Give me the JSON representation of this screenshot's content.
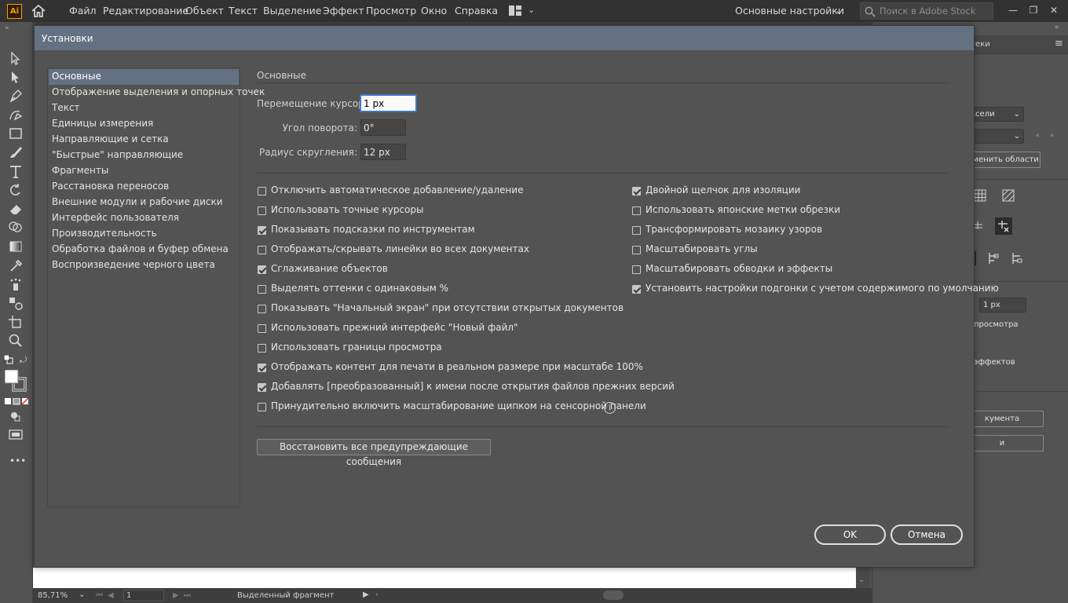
{
  "app": {
    "logo_text": "Ai",
    "menu": [
      "Файл",
      "Редактирование",
      "Объект",
      "Текст",
      "Выделение",
      "Эффект",
      "Просмотр",
      "Окно",
      "Справка"
    ],
    "workspace": "Основные настройки",
    "search_placeholder": "Поиск в Adobe Stock",
    "window_controls": [
      "—",
      "❐",
      "✕"
    ]
  },
  "toolbar": {
    "tools": [
      "selection-tool",
      "direct-selection-tool",
      "pen-tool",
      "curvature-tool",
      "rectangle-tool",
      "paintbrush-tool",
      "type-tool",
      "rotate-tool",
      "eraser-tool",
      "shape-builder-tool",
      "gradient-tool",
      "eyedropper-tool",
      "symbol-sprayer-tool",
      "blend-tool",
      "artboard-tool",
      "zoom-tool"
    ],
    "more": "•••"
  },
  "statusbar": {
    "zoom": "85,71%",
    "artboard": "1",
    "status": "Выделенный фрагмент"
  },
  "right_panel": {
    "tab_libraries": "блиотеки",
    "units_select": "ксели",
    "artboard_btn": "зменить области",
    "stroke_value": "1 px",
    "preview_text": "просмотра",
    "effects_text": "эффектов",
    "doc_btn": "кумента",
    "prefs_btn": "и"
  },
  "dialog": {
    "title": "Установки",
    "categories": [
      "Основные",
      "Отображение выделения и опорных точек",
      "Текст",
      "Единицы измерения",
      "Направляющие и сетка",
      "\"Быстрые\" направляющие",
      "Фрагменты",
      "Расстановка переносов",
      "Внешние модули и рабочие диски",
      "Интерфейс пользователя",
      "Производительность",
      "Обработка файлов и буфер обмена",
      "Воспроизведение черного цвета"
    ],
    "selected_category": "Основные",
    "section_title": "Основные",
    "fields": {
      "keyboard_increment_label": "Перемещение курсора:",
      "keyboard_increment_value": "1 px",
      "constrain_angle_label": "Угол поворота:",
      "constrain_angle_value": "0°",
      "corner_radius_label": "Радиус скругления:",
      "corner_radius_value": "12 px"
    },
    "options_left": [
      {
        "label": "Отключить автоматическое добавление/удаление",
        "checked": false
      },
      {
        "label": "Использовать точные курсоры",
        "checked": false
      },
      {
        "label": "Показывать подсказки по инструментам",
        "checked": true
      },
      {
        "label": "Отображать/скрывать линейки во всех документах",
        "checked": false
      },
      {
        "label": "Сглаживание объектов",
        "checked": true
      },
      {
        "label": "Выделять оттенки с одинаковым %",
        "checked": false
      },
      {
        "label": "Показывать \"Начальный экран\" при отсутствии открытых документов",
        "checked": false
      },
      {
        "label": "Использовать прежний интерфейс \"Новый файл\"",
        "checked": false
      },
      {
        "label": "Использовать границы просмотра",
        "checked": false
      },
      {
        "label": "Отображать контент для печати в реальном размере при масштабе 100%",
        "checked": true
      },
      {
        "label": "Добавлять [преобразованный] к имени после открытия файлов прежних версий",
        "checked": true
      },
      {
        "label": "Принудительно включить масштабирование щипком на сенсорной панели",
        "checked": false
      }
    ],
    "options_right": [
      {
        "label": "Двойной щелчок для изоляции",
        "checked": true
      },
      {
        "label": "Использовать японские метки обрезки",
        "checked": false
      },
      {
        "label": "Трансформировать мозаику узоров",
        "checked": false
      },
      {
        "label": "Масштабировать углы",
        "checked": false
      },
      {
        "label": "Масштабировать обводки и эффекты",
        "checked": false
      },
      {
        "label": "Установить настройки подгонки с учетом содержимого по умолчанию",
        "checked": true
      }
    ],
    "info_glyph": "i",
    "reset_warnings": "Восстановить все предупреждающие сообщения",
    "ok": "OK",
    "cancel": "Отмена"
  },
  "colors": {
    "dialog_titlebar": "#637183",
    "selected_category": "#637183",
    "app_bg": "#535353",
    "menubar": "#323232",
    "brand_orange": "#ff9a00"
  }
}
